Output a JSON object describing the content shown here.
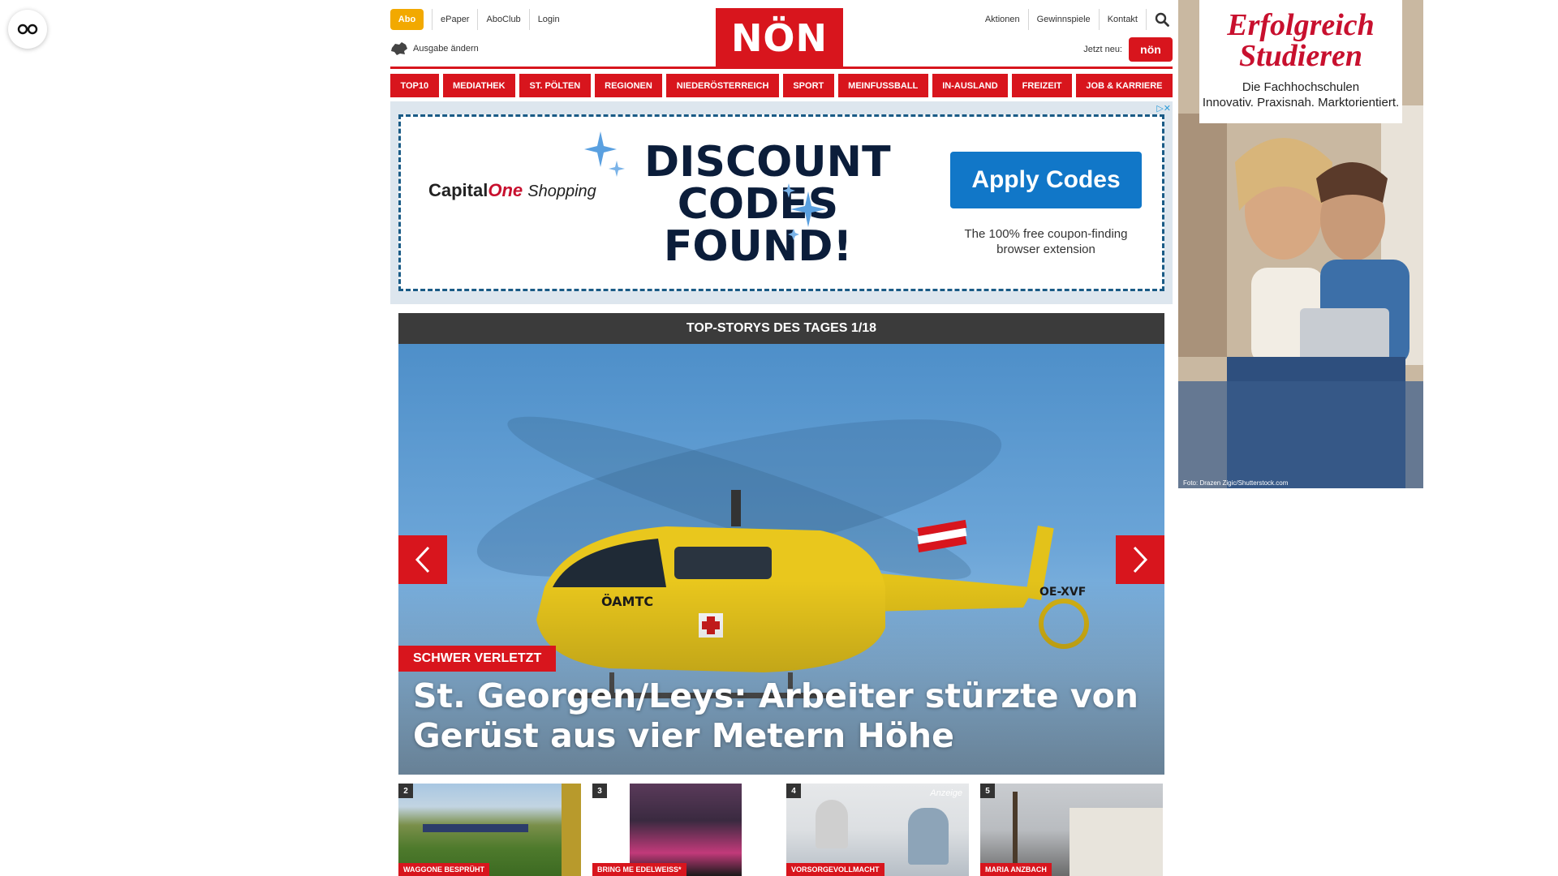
{
  "header": {
    "abo": "Abo",
    "top_links": [
      "ePaper",
      "AboClub",
      "Login"
    ],
    "ausgabe": "Ausgabe ändern",
    "logo": "NÖN",
    "right_links": [
      "Aktionen",
      "Gewinnspiele",
      "Kontakt"
    ],
    "jetzt_neu": "Jetzt neu:",
    "app_badge": "nön"
  },
  "nav": [
    "TOP10",
    "MEDIATHEK",
    "ST. PÖLTEN",
    "REGIONEN",
    "NIEDERÖSTERREICH",
    "SPORT",
    "MEINFUSSBALL",
    "IN-AUSLAND",
    "FREIZEIT",
    "JOB & KARRIERE"
  ],
  "top_ad": {
    "brand_capital": "Capital",
    "brand_one": "One",
    "brand_shopping": "Shopping",
    "headline_lines": [
      "DISCOUNT",
      "CODES",
      "FOUND!"
    ],
    "button": "Apply Codes",
    "subtext": "The 100% free coupon-finding browser extension"
  },
  "slider": {
    "header": "TOP-STORYS DES TAGES 1/18",
    "tag": "SCHWER VERLETZT",
    "headline": "St. Georgen/Leys: Arbeiter stürzte von Gerüst aus vier Metern Höhe",
    "heli_text": "ÖAMTC",
    "heli_reg": "OE-XVF"
  },
  "thumbs": [
    {
      "num": "2",
      "caption": "WAGGONE BESPRÜHT",
      "badge": ""
    },
    {
      "num": "3",
      "caption": "BRING ME EDELWEISS*",
      "badge": ""
    },
    {
      "num": "4",
      "caption": "VORSORGEVOLLMACHT",
      "badge": "Anzeige"
    },
    {
      "num": "5",
      "caption": "MARIA ANZBACH",
      "badge": ""
    }
  ],
  "side_ad": {
    "title_line1": "Erfolgreich",
    "title_line2": "Studieren",
    "sub_line1": "Die Fachhochschulen",
    "sub_line2": "Innovativ. Praxisnah. Marktorientiert.",
    "credit": "Foto: Drazen Zigic/Shutterstock.com"
  },
  "colors": {
    "brand_red": "#d8151d",
    "abo_yellow": "#f2a900",
    "apply_blue": "#1177c8"
  }
}
